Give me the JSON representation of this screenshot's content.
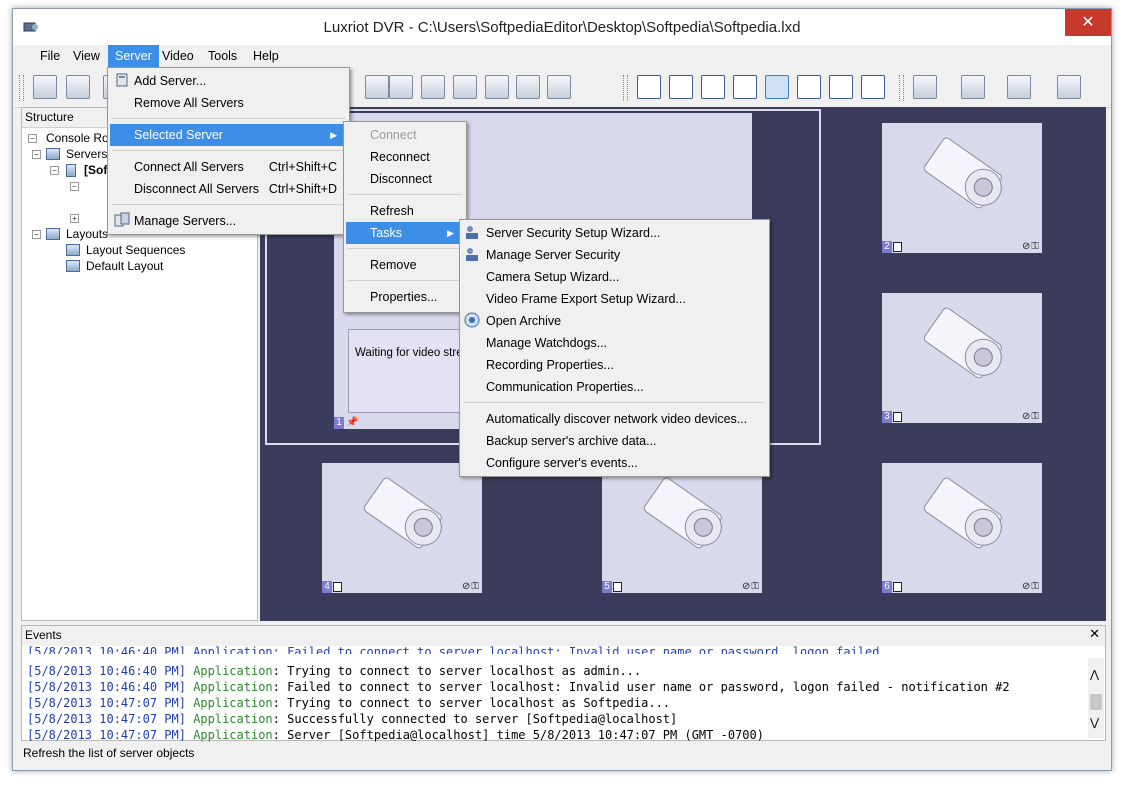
{
  "window": {
    "title": "Luxriot DVR - C:\\Users\\SoftpediaEditor\\Desktop\\Softpedia\\Softpedia.lxd",
    "close_symbol": "✕"
  },
  "menubar": {
    "items": [
      "File",
      "View",
      "Server",
      "Video",
      "Tools",
      "Help"
    ],
    "active": "Server"
  },
  "toolbar": {
    "icons": [
      "open-icon",
      "save-icon",
      "camera-play-icon",
      "camera-group-icon",
      "export-icon",
      "record-icon",
      "forward-icon",
      "monitor-icon"
    ],
    "layout_icons": [
      "layout-1x1-icon",
      "layout-2x2-icon",
      "layout-3x3-icon",
      "layout-4x4-icon",
      "layout-1plus5-icon",
      "layout-1plus7-icon",
      "layout-4x4b-icon",
      "layout-5x5-icon"
    ],
    "selected_layout": "layout-1plus5-icon"
  },
  "structure": {
    "title": "Structure",
    "tree": [
      "Console Roo",
      "Servers",
      "[Sof",
      "Layouts",
      "Layout Sequences",
      "Default Layout"
    ]
  },
  "server_menu": {
    "items": [
      {
        "label": "Add Server...",
        "shortcut": ""
      },
      {
        "label": "Remove All Servers",
        "shortcut": ""
      },
      {
        "label": "Selected Server",
        "shortcut": ""
      },
      {
        "label": "Connect All Servers",
        "shortcut": "Ctrl+Shift+C"
      },
      {
        "label": "Disconnect All Servers",
        "shortcut": "Ctrl+Shift+D"
      },
      {
        "label": "Manage Servers...",
        "shortcut": ""
      }
    ],
    "highlighted": "Selected Server"
  },
  "selected_server_menu": {
    "items": [
      "Connect",
      "Reconnect",
      "Disconnect",
      "Refresh",
      "Tasks",
      "Remove",
      "Properties..."
    ],
    "disabled": [
      "Connect"
    ],
    "highlighted": "Tasks"
  },
  "tasks_menu": {
    "items": [
      "Server Security Setup Wizard...",
      "Manage Server Security",
      "Camera Setup Wizard...",
      "Video Frame Export Setup Wizard...",
      "Open Archive",
      "Manage Watchdogs...",
      "Recording Properties...",
      "Communication Properties...",
      "Automatically discover network video devices...",
      "Backup server's archive data...",
      "Configure server's events..."
    ]
  },
  "video": {
    "main_camera": {
      "number": "1",
      "waiting_text": "Waiting for video strea"
    },
    "cameras": [
      "2",
      "3",
      "4",
      "5",
      "6"
    ],
    "flags": "⊘⚿"
  },
  "events": {
    "title": "Events",
    "close_symbol": "✕",
    "partial_line": "[5/8/2013 10:46:40 PM] Application: Failed to connect to server localhost: Invalid user name or password, logon failed",
    "entries": [
      {
        "time": "[5/8/2013 10:46:40 PM]",
        "source": "Application",
        "message": ": Trying to connect to server localhost as admin..."
      },
      {
        "time": "[5/8/2013 10:46:40 PM]",
        "source": "Application",
        "message": ": Failed to connect to server localhost: Invalid user name or password, logon failed - notification #2"
      },
      {
        "time": "[5/8/2013 10:47:07 PM]",
        "source": "Application",
        "message": ": Trying to connect to server localhost as Softpedia..."
      },
      {
        "time": "[5/8/2013 10:47:07 PM]",
        "source": "Application",
        "message": ": Successfully connected to server [Softpedia@localhost]"
      },
      {
        "time": "[5/8/2013 10:47:07 PM]",
        "source": "Application",
        "message": ": Server [Softpedia@localhost] time 5/8/2013 10:47:07 PM (GMT -0700)"
      }
    ],
    "scroll_up": "⋀",
    "scroll_down": "⋁"
  },
  "statusbar": {
    "text": "Refresh the list of server objects"
  },
  "colors": {
    "menu_highlight": "#3d8ee6",
    "video_bg": "#3b3b5c",
    "cam_bg": "#d9d9ec",
    "close": "#c7392b"
  }
}
